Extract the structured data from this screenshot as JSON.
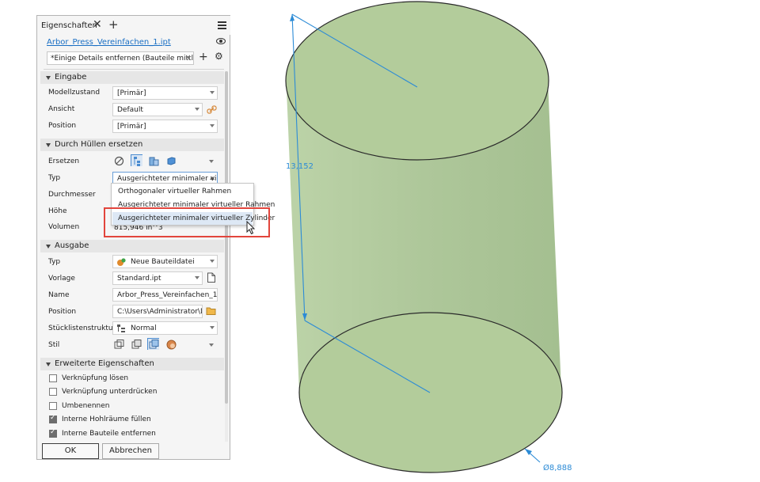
{
  "panel": {
    "tab_label": "Eigenschaften",
    "close_glyph": "✕",
    "add_glyph": "+",
    "file_name": "Arbor_Press_Vereinfachen_1.ipt",
    "detail_preset": "*Einige Details entfernen (Bauteile mittlerer",
    "plus_glyph": "+",
    "gear_glyph": "⚙"
  },
  "sections": {
    "eingabe": "Eingabe",
    "huellen": "Durch Hüllen ersetzen",
    "ausgabe": "Ausgabe",
    "erweitert": "Erweiterte Eigenschaften"
  },
  "eingabe": {
    "modellzustand_label": "Modellzustand",
    "modellzustand_value": "[Primär]",
    "ansicht_label": "Ansicht",
    "ansicht_value": "Default",
    "position_label": "Position",
    "position_value": "[Primär]"
  },
  "huellen": {
    "ersetzen_label": "Ersetzen",
    "typ_label": "Typ",
    "typ_value": "Ausgerichteter minimaler vi...",
    "durchmesser_label": "Durchmesser",
    "hoehe_label": "Höhe",
    "volumen_label": "Volumen",
    "volumen_value": "815,946 in^3"
  },
  "typ_dropdown": {
    "options": [
      "Orthogonaler virtueller Rahmen",
      "Ausgerichteter minimaler virtueller Rahmen",
      "Ausgerichteter minimaler virtueller Zylinder"
    ],
    "selected_index": 2
  },
  "ausgabe": {
    "typ_label": "Typ",
    "typ_value": "Neue Bauteildatei",
    "vorlage_label": "Vorlage",
    "vorlage_value": "Standard.ipt",
    "name_label": "Name",
    "name_value": "Arbor_Press_Vereinfachen_1",
    "position_label": "Position",
    "position_value": "C:\\Users\\Administrator\\Deskt",
    "stueckliste_label": "Stücklistenstruktur",
    "stueckliste_value": "Normal",
    "stil_label": "Stil"
  },
  "erweitert": {
    "options": [
      {
        "label": "Verknüpfung lösen",
        "checked": false
      },
      {
        "label": "Verknüpfung unterdrücken",
        "checked": false
      },
      {
        "label": "Umbenennen",
        "checked": false
      },
      {
        "label": "Interne Hohlräume füllen",
        "checked": true
      },
      {
        "label": "Interne Bauteile entfernen",
        "checked": true
      }
    ]
  },
  "buttons": {
    "ok": "OK",
    "cancel": "Abbrechen"
  },
  "viewport": {
    "height_dimension": "13,152",
    "diameter_dimension": "Ø8,888",
    "cylinder_fill": "#b3cc9b",
    "dimension_color": "#2c8bd6"
  },
  "colors": {
    "accent": "#1a6fc4",
    "highlight_box": "#e2453c",
    "selection": "#dde8f5"
  }
}
